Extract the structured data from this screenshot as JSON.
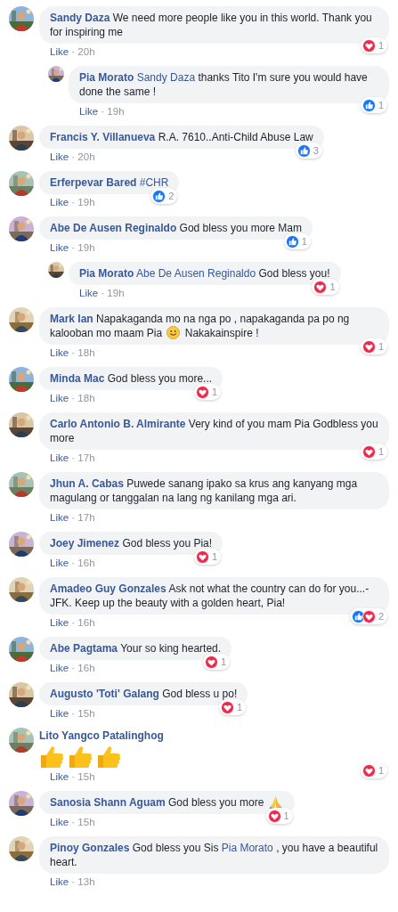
{
  "separator": "·",
  "comments": [
    {
      "kind": "text",
      "author": "Sandy Daza",
      "body": [
        {
          "kind": "text",
          "text": "We need more people like you in this world. Thank you for inspiring me"
        }
      ],
      "like_label": "Like",
      "time": "20h",
      "reactions": {
        "icons": [
          {
            "kind": "love"
          }
        ],
        "count": "1"
      },
      "replies": [
        {
          "kind": "text",
          "author": "Pia Morato",
          "body": [
            {
              "kind": "mention",
              "text": "Sandy Daza"
            },
            {
              "kind": "text",
              "text": "thanks Tito I'm sure you would have done the same !"
            }
          ],
          "like_label": "Like",
          "time": "19h",
          "reactions": {
            "icons": [
              {
                "kind": "like"
              }
            ],
            "count": "1"
          }
        }
      ]
    },
    {
      "kind": "text",
      "author": "Francis Y. Villanueva",
      "body": [
        {
          "kind": "text",
          "text": "R.A. 7610..Anti-Child Abuse Law"
        }
      ],
      "like_label": "Like",
      "time": "20h",
      "reactions": {
        "icons": [
          {
            "kind": "like"
          }
        ],
        "count": "3"
      }
    },
    {
      "kind": "text",
      "author": "Erferpevar Bared",
      "body": [
        {
          "kind": "hashtag",
          "text": "#CHR"
        }
      ],
      "like_label": "Like",
      "time": "19h",
      "reactions": {
        "icons": [
          {
            "kind": "like"
          }
        ],
        "count": "2"
      }
    },
    {
      "kind": "text",
      "author": "Abe De Ausen Reginaldo",
      "body": [
        {
          "kind": "text",
          "text": "God bless you more Mam"
        }
      ],
      "like_label": "Like",
      "time": "19h",
      "reactions": {
        "icons": [
          {
            "kind": "like"
          }
        ],
        "count": "1"
      },
      "replies": [
        {
          "kind": "text",
          "author": "Pia Morato",
          "body": [
            {
              "kind": "mention",
              "text": "Abe De Ausen Reginaldo"
            },
            {
              "kind": "text",
              "text": "God bless you!"
            }
          ],
          "like_label": "Like",
          "time": "19h",
          "reactions": {
            "icons": [
              {
                "kind": "love"
              }
            ],
            "count": "1"
          }
        }
      ]
    },
    {
      "kind": "text",
      "author": "Mark Ian",
      "body": [
        {
          "kind": "text",
          "text": "Napakaganda mo na nga po , napakaganda pa po ng kalooban mo maam Pia"
        },
        {
          "kind": "smile"
        },
        {
          "kind": "text",
          "text": "Nakakainspire !"
        }
      ],
      "like_label": "Like",
      "time": "18h",
      "reactions": {
        "icons": [
          {
            "kind": "love"
          }
        ],
        "count": "1"
      }
    },
    {
      "kind": "text",
      "author": "Minda Mac",
      "body": [
        {
          "kind": "text",
          "text": "God bless you more..."
        }
      ],
      "like_label": "Like",
      "time": "18h",
      "reactions": {
        "icons": [
          {
            "kind": "love"
          }
        ],
        "count": "1"
      }
    },
    {
      "kind": "text",
      "author": "Carlo Antonio B. Almirante",
      "body": [
        {
          "kind": "text",
          "text": "Very kind of you mam Pia Godbless you more"
        }
      ],
      "like_label": "Like",
      "time": "17h",
      "reactions": {
        "icons": [
          {
            "kind": "love"
          }
        ],
        "count": "1"
      }
    },
    {
      "kind": "text",
      "author": "Jhun A. Cabas",
      "body": [
        {
          "kind": "text",
          "text": "Puwede sanang ipako sa krus ang kanyang mga magulang or tanggalan na lang ng kanilang mga ari."
        }
      ],
      "like_label": "Like",
      "time": "17h"
    },
    {
      "kind": "text",
      "author": "Joey Jimenez",
      "body": [
        {
          "kind": "text",
          "text": "God bless you Pia!"
        }
      ],
      "like_label": "Like",
      "time": "16h",
      "reactions": {
        "icons": [
          {
            "kind": "love"
          }
        ],
        "count": "1"
      }
    },
    {
      "kind": "text",
      "author": "Amadeo Guy Gonzales",
      "body": [
        {
          "kind": "text",
          "text": "Ask not what the country can do for you...- JFK. Keep up the beauty with a golden heart, Pia!"
        }
      ],
      "like_label": "Like",
      "time": "16h",
      "reactions": {
        "icons": [
          {
            "kind": "like"
          },
          {
            "kind": "love"
          }
        ],
        "count": "2"
      }
    },
    {
      "kind": "text",
      "author": "Abe Pagtama",
      "body": [
        {
          "kind": "text",
          "text": "Your so king hearted."
        }
      ],
      "like_label": "Like",
      "time": "16h",
      "reactions": {
        "icons": [
          {
            "kind": "love"
          }
        ],
        "count": "1"
      }
    },
    {
      "kind": "text",
      "author": "Augusto 'Toti' Galang",
      "body": [
        {
          "kind": "text",
          "text": "God bless u po!"
        }
      ],
      "like_label": "Like",
      "time": "15h",
      "reactions": {
        "icons": [
          {
            "kind": "love"
          }
        ],
        "count": "1"
      }
    },
    {
      "kind": "emoji",
      "author": "Lito Yangco Patalinghog",
      "body": [
        {
          "kind": "thumbs"
        },
        {
          "kind": "thumbs"
        },
        {
          "kind": "thumbs"
        }
      ],
      "like_label": "Like",
      "time": "15h",
      "reactions": {
        "icons": [
          {
            "kind": "love"
          }
        ],
        "count": "1"
      }
    },
    {
      "kind": "text",
      "author": "Sanosia Shann Aguam",
      "body": [
        {
          "kind": "text",
          "text": "God bless you more"
        },
        {
          "kind": "pray"
        }
      ],
      "like_label": "Like",
      "time": "15h",
      "reactions": {
        "icons": [
          {
            "kind": "love"
          }
        ],
        "count": "1"
      }
    },
    {
      "kind": "text",
      "author": "Pinoy Gonzales",
      "body": [
        {
          "kind": "text",
          "text": "God bless you Sis"
        },
        {
          "kind": "mention",
          "text": "Pia Morato"
        },
        {
          "kind": "text",
          "text": ", you have a beautiful heart."
        }
      ],
      "like_label": "Like",
      "time": "13h"
    }
  ]
}
